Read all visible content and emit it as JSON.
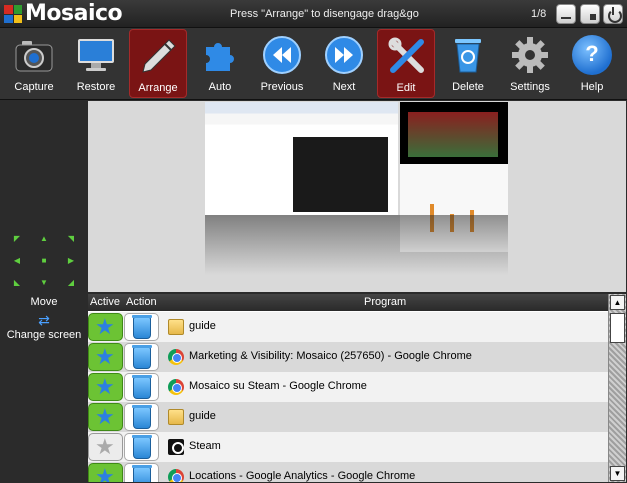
{
  "titlebar": {
    "app_title": "Mosaico",
    "hint": "Press \"Arrange\" to disengage drag&go",
    "page_indicator": "1/8",
    "buttons": [
      "minimize",
      "fullscreen",
      "power"
    ]
  },
  "toolbar": {
    "items": [
      {
        "label": "Capture",
        "icon": "camera-icon",
        "active": false
      },
      {
        "label": "Restore",
        "icon": "monitor-icon",
        "active": false
      },
      {
        "label": "Arrange",
        "icon": "pencil-icon",
        "active": true
      },
      {
        "label": "Auto",
        "icon": "puzzle-icon",
        "active": false
      },
      {
        "label": "Previous",
        "icon": "rewind-icon",
        "active": false
      },
      {
        "label": "Next",
        "icon": "fast-forward-icon",
        "active": false
      },
      {
        "label": "Edit",
        "icon": "tools-icon",
        "active": true
      },
      {
        "label": "Delete",
        "icon": "recycle-bin-icon",
        "active": false
      },
      {
        "label": "Settings",
        "icon": "gear-icon",
        "active": false
      },
      {
        "label": "Help",
        "icon": "help-icon",
        "active": false
      }
    ]
  },
  "left_panel": {
    "move_label": "Move",
    "change_screen_label": "Change screen"
  },
  "table": {
    "headers": {
      "active": "Active",
      "action": "Action",
      "program": "Program"
    },
    "rows": [
      {
        "active": true,
        "icon": "folder-icon",
        "program": "guide"
      },
      {
        "active": true,
        "icon": "chrome-icon",
        "program": "Marketing & Visibility: Mosaico (257650) - Google Chrome"
      },
      {
        "active": true,
        "icon": "chrome-icon",
        "program": "Mosaico su Steam - Google Chrome"
      },
      {
        "active": true,
        "icon": "folder-icon",
        "program": "guide"
      },
      {
        "active": false,
        "icon": "steam-icon",
        "program": "Steam"
      },
      {
        "active": true,
        "icon": "chrome-icon",
        "program": "Locations - Google Analytics - Google Chrome"
      }
    ]
  },
  "colors": {
    "active_tool": "#7a1414",
    "active_green": "#6cc334",
    "star_blue": "#2d7fe0"
  }
}
